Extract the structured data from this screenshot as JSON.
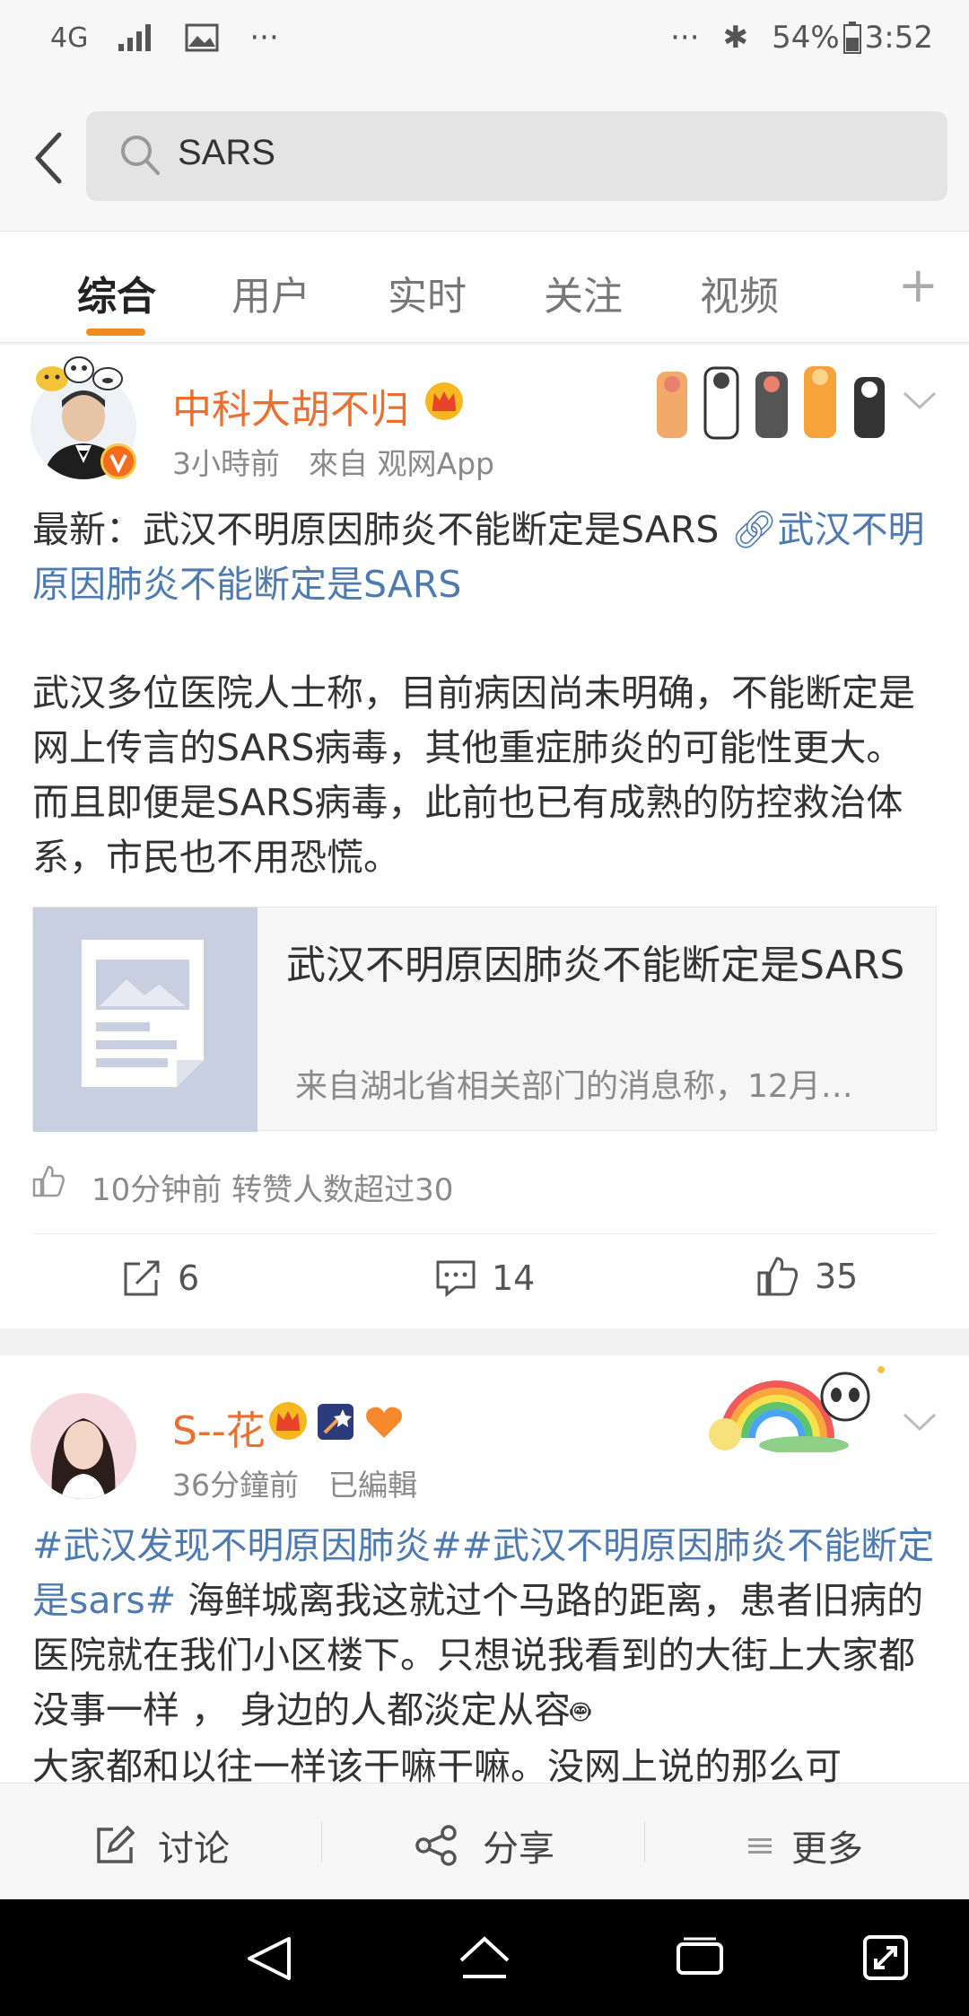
{
  "status_bar": {
    "network": "4G",
    "battery": "54%",
    "time": "3:52",
    "dots_left": "···",
    "dots_right": "···"
  },
  "search": {
    "query": "SARS"
  },
  "tabs": [
    {
      "label": "综合"
    },
    {
      "label": "用户"
    },
    {
      "label": "实时"
    },
    {
      "label": "关注"
    },
    {
      "label": "视频"
    }
  ],
  "tab_more": "+",
  "post1": {
    "username": "中科大胡不归",
    "time": "3小時前",
    "source": "來自 观网App",
    "text_prefix": "最新：武汉不明原因肺炎不能断定是SARS ",
    "link_text": "武汉不明原因肺炎不能断定是SARS",
    "paragraph": "武汉多位医院人士称，目前病因尚未明确，不能断定是网上传言的SARS病毒，其他重症肺炎的可能性更大。而且即便是SARS病毒，此前也已有成熟的防控救治体系，市民也不用恐慌。",
    "card_title": "武汉不明原因肺炎不能断定是SARS",
    "card_summary": "来自湖北省相关部门的消息称，12月…",
    "hot_line": "10分钟前 转赞人数超过30",
    "repost_count": "6",
    "comment_count": "14",
    "like_count": "35"
  },
  "post2": {
    "username": "S--花",
    "time": "36分鐘前",
    "edited": "已編輯",
    "hashtag1": "#武汉发现不明原因肺炎#",
    "hashtag2": "#武汉不明原因肺炎不能断定是sars#",
    "text": " 海鲜城离我这就过个马路的距离，患者旧病的医院就在我们小区楼下。只想说我看到的大街上大家都没事一样 ， 身边的人都淡定从容",
    "text_cont": "大家都和以往一样该干嘛干嘛。没网上说的那么可"
  },
  "bottom_bar": {
    "discuss": "讨论",
    "share": "分享",
    "more": "更多"
  },
  "colors": {
    "accent": "#f08a1c",
    "username": "#eb7030",
    "link": "#4d7bb1"
  }
}
